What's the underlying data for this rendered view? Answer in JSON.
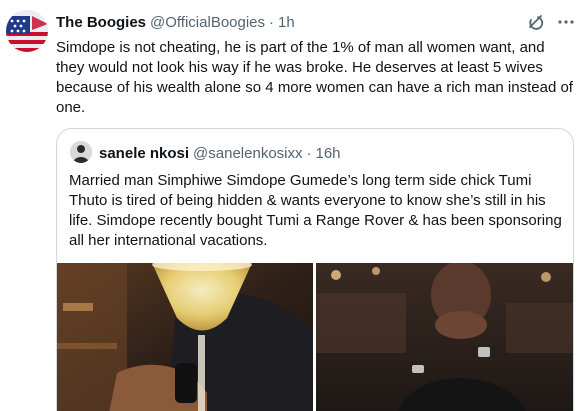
{
  "tweet": {
    "author_name": "The Boogies",
    "author_handle": "@OfficialBoogies",
    "separator": "·",
    "time": "1h",
    "text": "Simdope is not cheating, he is part of the 1% of man all women want, and they would not look his way if he was broke. He deserves at least 5 wives because of his wealth alone so 4 more women can have a rich man instead of one."
  },
  "quoted_tweet": {
    "author_name": "sanele nkosi",
    "author_handle": "@sanelenkosixx",
    "separator": "·",
    "time": "16h",
    "text": "Married man Simphiwe Simdope Gumede’s long term side chick Tumi Thuto is tired of being hidden & wants everyone to know she’s still in his life. Simdope recently bought Tumi a Range Rover & has been sponsoring all her international vacations."
  },
  "icons": {
    "grok": "grok-icon",
    "more": "more-icon"
  },
  "colors": {
    "text_primary": "#0f1419",
    "text_secondary": "#536471",
    "border": "#cfd9de"
  }
}
